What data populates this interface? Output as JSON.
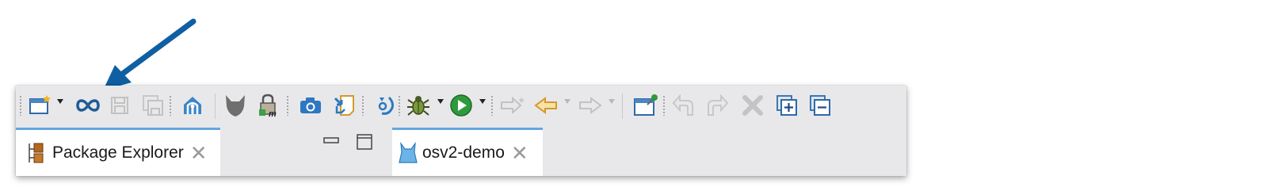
{
  "toolbar": {
    "buttons": [
      {
        "name": "new-wizard-button",
        "icon": "new-window-icon",
        "enabled": true,
        "dropdown": true
      },
      {
        "name": "infinity-tool-button",
        "icon": "infinity-icon",
        "enabled": true,
        "dropdown": false
      },
      {
        "name": "save-button",
        "icon": "save-icon",
        "enabled": false
      },
      {
        "name": "save-all-button",
        "icon": "save-all-icon",
        "enabled": false
      },
      {
        "name": "home-button",
        "icon": "home-icon",
        "enabled": true
      },
      {
        "name": "perspective-button",
        "icon": "mask-icon",
        "enabled": true
      },
      {
        "name": "lock-build-button",
        "icon": "lock-icon",
        "enabled": true
      },
      {
        "name": "camera-button",
        "icon": "camera-icon",
        "enabled": true
      },
      {
        "name": "import-button",
        "icon": "import-icon",
        "enabled": true
      },
      {
        "name": "rotate-button",
        "icon": "rotate-icon",
        "enabled": true
      },
      {
        "name": "debug-button",
        "icon": "bug-icon",
        "enabled": true,
        "dropdown": true
      },
      {
        "name": "run-button",
        "icon": "play-icon",
        "enabled": true,
        "dropdown": true
      },
      {
        "name": "next-edit-button",
        "icon": "arrow-right-star-icon",
        "enabled": false
      },
      {
        "name": "back-button",
        "icon": "arrow-left-icon",
        "enabled": true,
        "dropdown": true
      },
      {
        "name": "forward-button",
        "icon": "arrow-right-icon",
        "enabled": false,
        "dropdown": true
      },
      {
        "name": "pin-editor-button",
        "icon": "pin-window-icon",
        "enabled": true
      },
      {
        "name": "undo-button",
        "icon": "undo-icon",
        "enabled": false
      },
      {
        "name": "redo-button",
        "icon": "redo-icon",
        "enabled": false
      },
      {
        "name": "delete-button",
        "icon": "delete-icon",
        "enabled": false
      },
      {
        "name": "expand-all-button",
        "icon": "expand-all-icon",
        "enabled": true
      },
      {
        "name": "collapse-all-button",
        "icon": "collapse-all-icon",
        "enabled": true
      }
    ]
  },
  "tabs": {
    "package_explorer": {
      "label": "Package Explorer",
      "close": "✕",
      "icon": "package-explorer-icon"
    },
    "editor": {
      "label": "osv2-demo",
      "close": "✕",
      "icon": "dress-icon"
    }
  },
  "view_controls": {
    "minimize": "minimize-icon",
    "maximize": "maximize-icon"
  },
  "colors": {
    "accent": "#62a7e0",
    "panel": "#e8e8ea",
    "arrow": "#0f5fa3"
  }
}
